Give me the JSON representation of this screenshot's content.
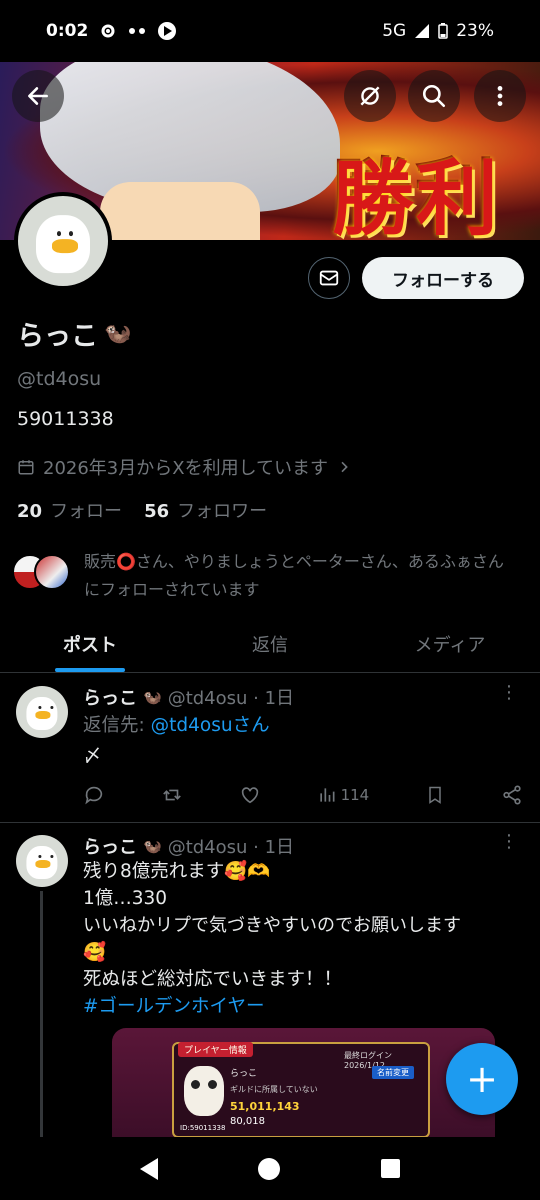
{
  "status_bar": {
    "time": "0:02",
    "network": "5G",
    "battery": "23%"
  },
  "banner": {
    "art_text": "勝利"
  },
  "profile": {
    "follow_label": "フォローする",
    "name": "らっこ",
    "name_emoji": "🦦",
    "handle": "@td4osu",
    "bio": "59011338",
    "joined": "2026年3月からXを利用しています",
    "following_count": "20",
    "following_label": "フォロー",
    "followers_count": "56",
    "followers_label": "フォロワー",
    "followed_by": "販売⭕さん、やりましょうとペーターさん、あるふぁさんにフォローされています"
  },
  "tabs": [
    {
      "label": "ポスト",
      "active": true
    },
    {
      "label": "返信",
      "active": false
    },
    {
      "label": "メディア",
      "active": false
    }
  ],
  "posts": [
    {
      "name": "らっこ",
      "emoji": "🦦",
      "handle_time": "@td4osu · 1日",
      "reply_prefix": "返信先: ",
      "reply_to": "@td4osuさん",
      "text": "〆",
      "views": "114"
    },
    {
      "name": "らっこ",
      "emoji": "🦦",
      "handle_time": "@td4osu · 1日",
      "line1": "残り8億売れます🥰🫶",
      "line2": "1億…330",
      "line3": "いいねかリプで気づきやすいのでお願いします",
      "line4": "🥰",
      "line5": "死ぬほど総対応でいきます！！",
      "hashtag": "#ゴールデンホイヤー"
    }
  ],
  "game_screenshot": {
    "player_tag": "プレイヤー情報",
    "login": "最終ログイン　2026/1/12",
    "rename": "名前変更",
    "name": "らっこ",
    "guild": "ギルドに所属していない",
    "coins": "51,011,143",
    "gems": "80,018",
    "id": "ID:59011338"
  },
  "fab_label": "+"
}
